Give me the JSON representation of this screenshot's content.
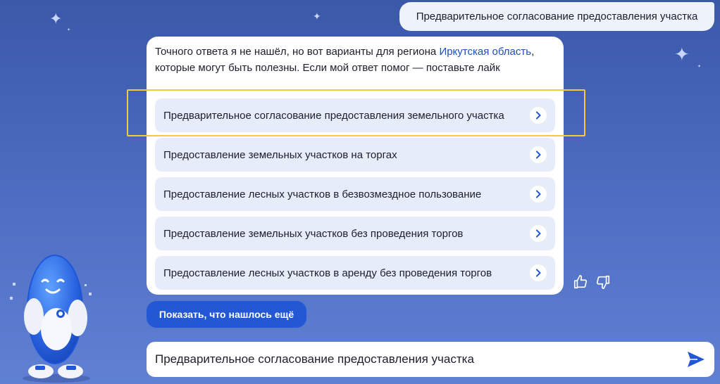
{
  "chat": {
    "user_message": "Предварительное согласование предоставления участка",
    "bot_reply": {
      "text_before": "Точного ответа я не нашёл, но вот варианты для региона ",
      "region_link": "Иркутская область",
      "text_after": ", которые могут быть полезны. Если мой ответ помог — поставьте лайк"
    },
    "options": [
      {
        "label": "Предварительное согласование предоставления земельного участка"
      },
      {
        "label": "Предоставление земельных участков на торгах"
      },
      {
        "label": "Предоставление лесных участков в безвозмездное пользование"
      },
      {
        "label": "Предоставление земельных участков без проведения торгов"
      },
      {
        "label": "Предоставление лесных участков в аренду без проведения торгов"
      }
    ],
    "more_button": "Показать, что нашлось ещё"
  },
  "input": {
    "value": "Предварительное согласование предоставления участка"
  },
  "icons": {
    "option_arrow": "chevron-right-icon",
    "like": "thumbs-up-icon",
    "dislike": "thumbs-down-icon",
    "send": "send-icon",
    "mascot": "robot-mascot"
  },
  "colors": {
    "accent": "#2357d4",
    "highlight_frame": "#f2cc3b",
    "link": "#1e4fba",
    "option_bg": "#e7ecfa"
  }
}
